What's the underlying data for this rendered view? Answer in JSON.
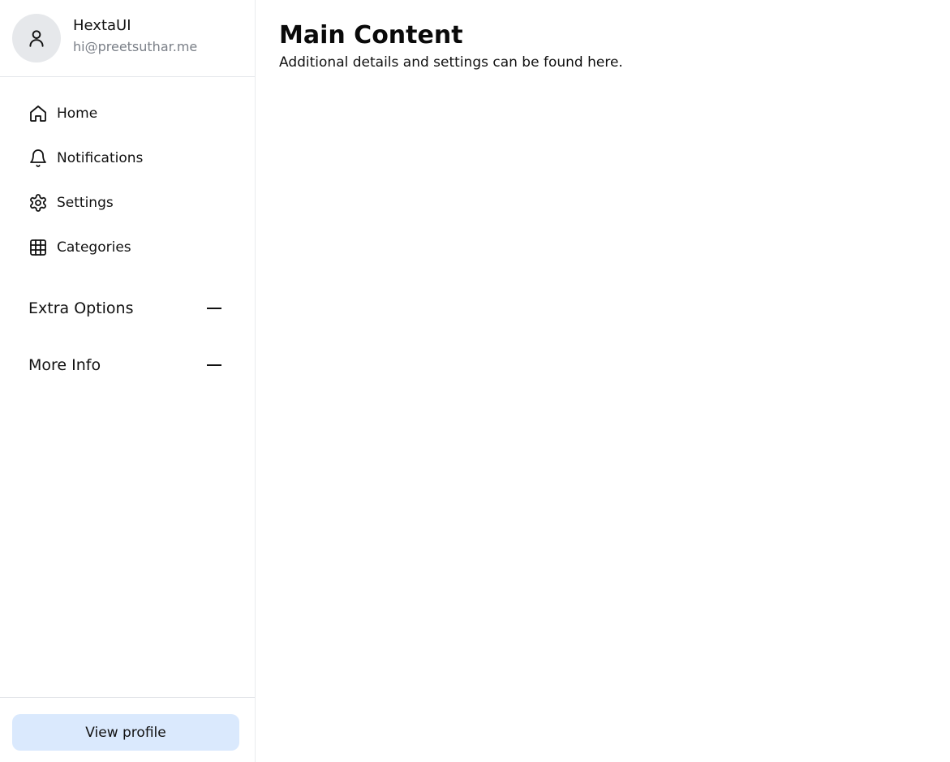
{
  "profile": {
    "name": "HextaUI",
    "email": "hi@preetsuthar.me",
    "avatar_icon": "user-icon"
  },
  "nav": {
    "items": [
      {
        "label": "Home",
        "icon": "home-icon"
      },
      {
        "label": "Notifications",
        "icon": "bell-icon"
      },
      {
        "label": "Settings",
        "icon": "gear-icon"
      },
      {
        "label": "Categories",
        "icon": "grid-icon"
      }
    ]
  },
  "sections": [
    {
      "title": "Extra Options",
      "icon": "minus-icon"
    },
    {
      "title": "More Info",
      "icon": "minus-icon"
    }
  ],
  "footer": {
    "view_profile_label": "View profile",
    "button_color": "#dae9fd"
  },
  "main": {
    "title": "Main Content",
    "subtitle": "Additional details and settings can be found here."
  }
}
